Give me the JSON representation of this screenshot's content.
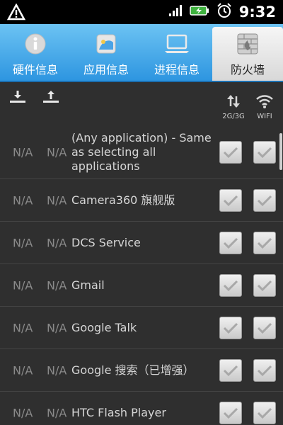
{
  "status_bar": {
    "time": "9:32"
  },
  "tabs": [
    {
      "label": "硬件信息",
      "icon": "info-icon"
    },
    {
      "label": "应用信息",
      "icon": "apps-icon"
    },
    {
      "label": "进程信息",
      "icon": "laptop-icon"
    },
    {
      "label": "防火墙",
      "icon": "firewall-icon",
      "active": true
    }
  ],
  "toolbar": {
    "col_mobile_label": "2G/3G",
    "col_wifi_label": "WIFI"
  },
  "rows": [
    {
      "na1": "N/A",
      "na2": "N/A",
      "name": "(Any application) - Same as selecting all applications",
      "mobile_checked": true,
      "wifi_checked": true
    },
    {
      "na1": "N/A",
      "na2": "N/A",
      "name": "Camera360 旗舰版",
      "mobile_checked": true,
      "wifi_checked": true
    },
    {
      "na1": "N/A",
      "na2": "N/A",
      "name": "DCS Service",
      "mobile_checked": true,
      "wifi_checked": true
    },
    {
      "na1": "N/A",
      "na2": "N/A",
      "name": "Gmail",
      "mobile_checked": true,
      "wifi_checked": true
    },
    {
      "na1": "N/A",
      "na2": "N/A",
      "name": "Google Talk",
      "mobile_checked": true,
      "wifi_checked": true
    },
    {
      "na1": "N/A",
      "na2": "N/A",
      "name": "Google 搜索（已增强）",
      "mobile_checked": true,
      "wifi_checked": true
    },
    {
      "na1": "N/A",
      "na2": "N/A",
      "name": "HTC Flash Player",
      "mobile_checked": true,
      "wifi_checked": true
    }
  ]
}
